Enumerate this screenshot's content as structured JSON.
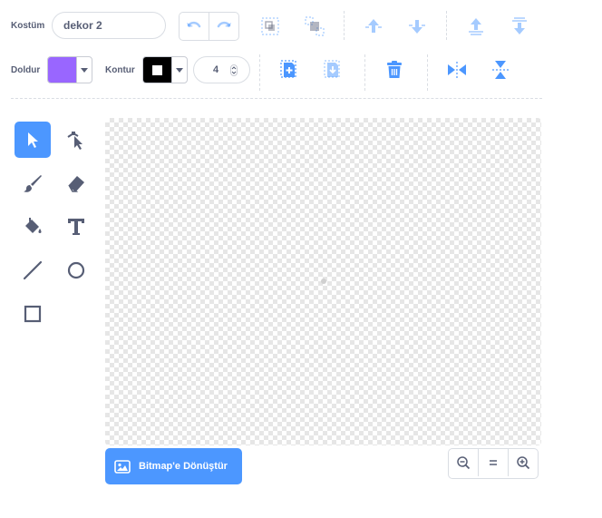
{
  "costume": {
    "label": "Kostüm",
    "name_value": "dekor 2"
  },
  "fill": {
    "label": "Doldur",
    "color": "#9966ff"
  },
  "outline": {
    "label": "Kontur",
    "color": "#000000",
    "width_value": "4"
  },
  "toolbar": {
    "undo_icon": "undo-icon",
    "redo_icon": "redo-icon",
    "group_icon": "group-icon",
    "ungroup_icon": "ungroup-icon",
    "forward_icon": "forward-icon",
    "backward_icon": "backward-icon",
    "front_icon": "front-icon",
    "back_icon": "back-icon",
    "copy_icon": "copy-icon",
    "paste_icon": "paste-icon",
    "delete_icon": "delete-icon",
    "flip_h_icon": "flip-horizontal-icon",
    "flip_v_icon": "flip-vertical-icon"
  },
  "tools": [
    "select",
    "reshape",
    "brush",
    "eraser",
    "fill",
    "text",
    "line",
    "circle",
    "rectangle"
  ],
  "active_tool": "select",
  "convert_button": {
    "label": "Bitmap'e Dönüştür"
  },
  "zoom": {
    "zoom_out_icon": "zoom-out-icon",
    "reset_icon": "zoom-reset-icon",
    "zoom_in_icon": "zoom-in-icon"
  },
  "colors": {
    "accent": "#4c97ff",
    "text": "#575e75",
    "border": "#d9dde3"
  }
}
